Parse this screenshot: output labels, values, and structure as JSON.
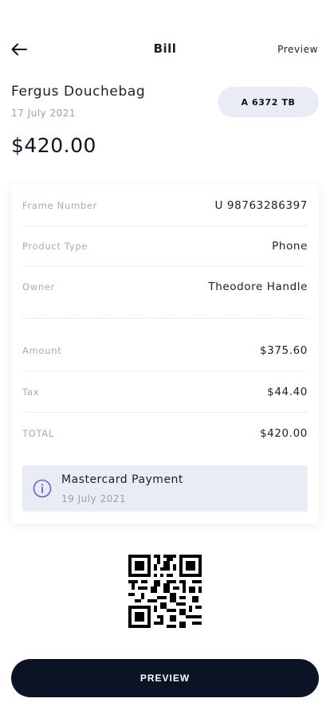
{
  "header": {
    "title": "Bill",
    "preview_link": "Preview"
  },
  "customer": {
    "name": "Fergus Douchebag",
    "date": "17 July 2021",
    "plate": "A 6372 TB",
    "total": "$420.00"
  },
  "details": {
    "rows": [
      {
        "label": "Frame Number",
        "value": "U 98763286397"
      },
      {
        "label": "Product Type",
        "value": "Phone"
      },
      {
        "label": "Owner",
        "value": "Theodore Handle"
      }
    ],
    "charges": [
      {
        "label": "Amount",
        "value": "$375.60"
      },
      {
        "label": "Tax",
        "value": "$44.40"
      },
      {
        "label": "TOTAL",
        "value": "$420.00"
      }
    ]
  },
  "payment": {
    "title": "Mastercard Payment",
    "date": "19 July 2021",
    "icon": "info-icon"
  },
  "footer": {
    "button_label": "PREVIEW"
  },
  "colors": {
    "primary_dark": "#0b1324",
    "badge_bg": "#e9ecf4",
    "accent_icon": "#5a67c8",
    "muted_text": "#a7abb3"
  }
}
